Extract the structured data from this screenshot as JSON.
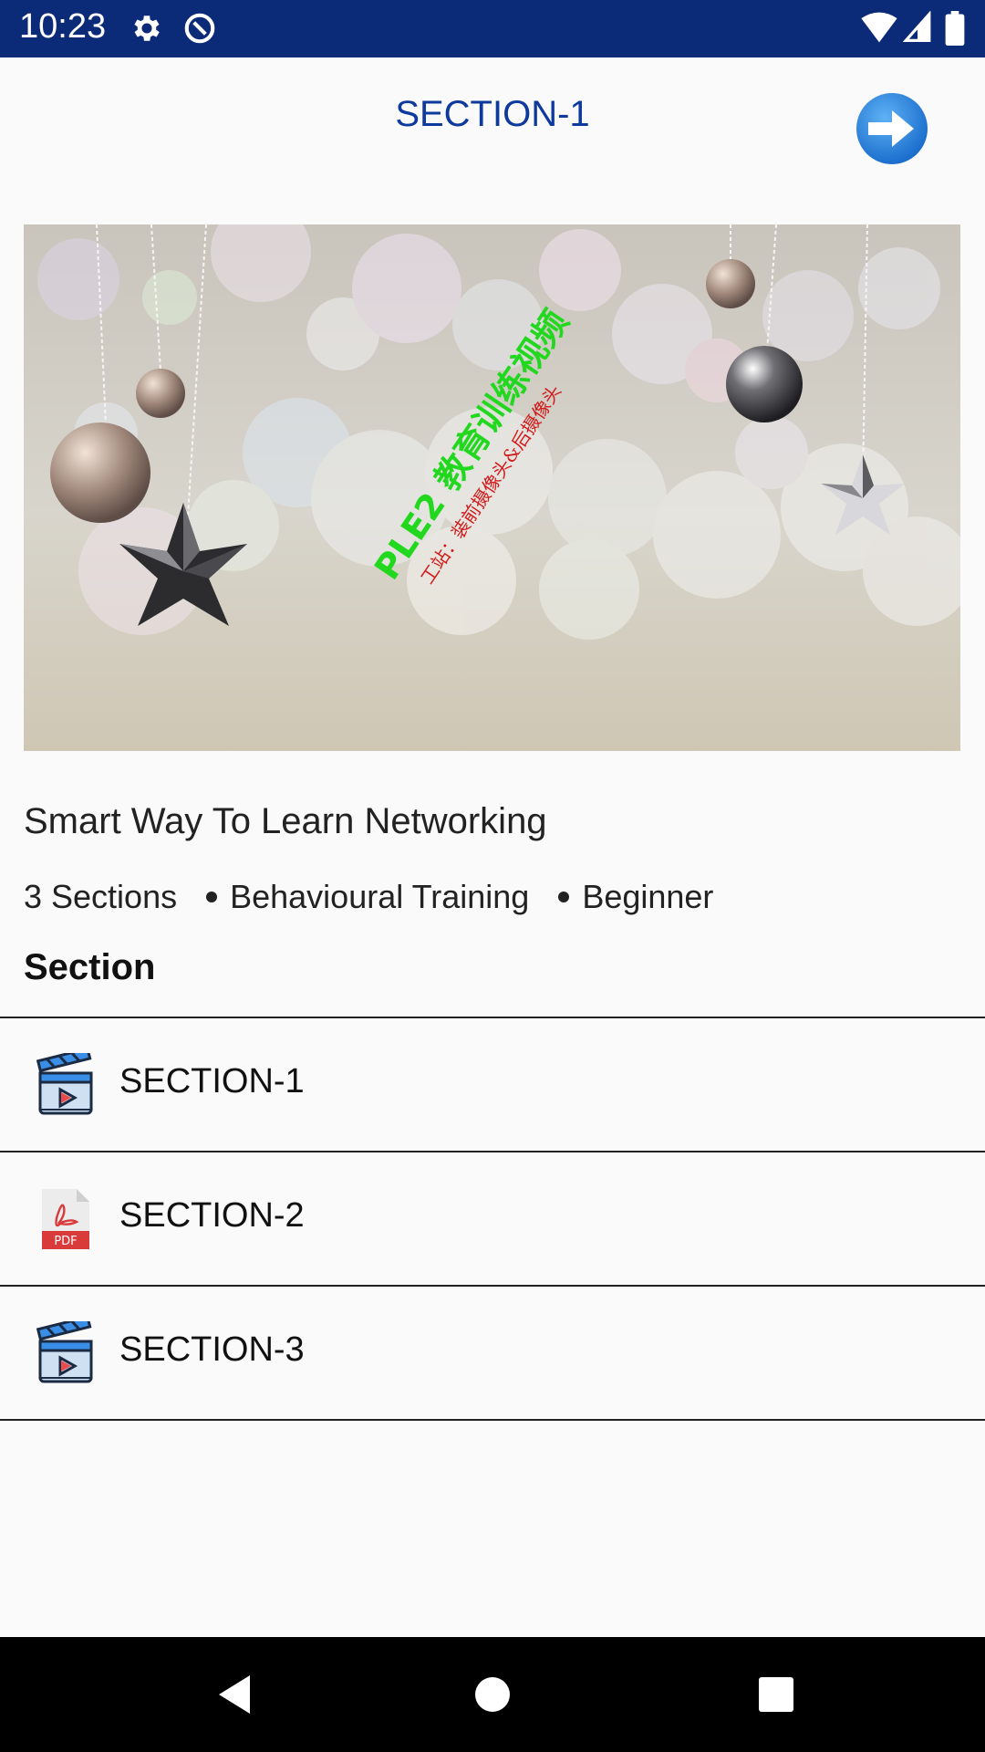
{
  "status_bar": {
    "time": "10:23",
    "left_icons": [
      "gear-icon",
      "data-saver-icon"
    ],
    "right_icons": [
      "wifi-icon",
      "cellular-signal-icon",
      "battery-icon"
    ],
    "background": "#0b2a78"
  },
  "app_bar": {
    "title": "SECTION-1",
    "next_icon": "arrow-right-circle-icon",
    "accent": "#0d3a9c"
  },
  "hero": {
    "watermark_main": "PLE2 教育训练视频",
    "watermark_sub": "工站：装前摄像头&后摄像头"
  },
  "course": {
    "title": "Smart Way To Learn Networking",
    "sections_count": "3 Sections",
    "category": "Behavioural Training",
    "level": "Beginner"
  },
  "section_heading": "Section",
  "sections": [
    {
      "label": "SECTION-1",
      "icon": "video-clapperboard-icon"
    },
    {
      "label": "SECTION-2",
      "icon": "pdf-file-icon",
      "icon_text": "PDF"
    },
    {
      "label": "SECTION-3",
      "icon": "video-clapperboard-icon"
    }
  ],
  "nav_bar": {
    "buttons": [
      "back-triangle-icon",
      "home-circle-icon",
      "recents-square-icon"
    ]
  }
}
